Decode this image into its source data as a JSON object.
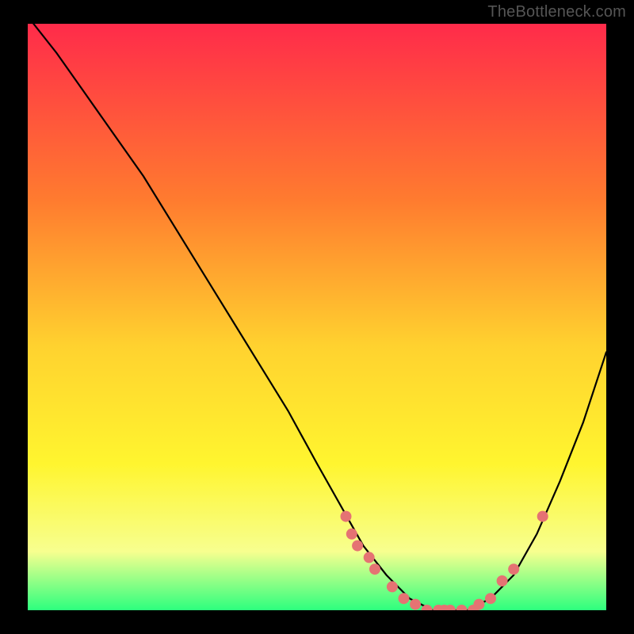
{
  "watermark": "TheBottleneck.com",
  "colors": {
    "background": "#000000",
    "gradient_top": "#ff2b4a",
    "gradient_mid1": "#ff7b2f",
    "gradient_mid2": "#ffd22f",
    "gradient_mid3": "#fff52f",
    "gradient_bottom_band": "#f7ff8f",
    "gradient_bottom": "#2dff7e",
    "curve": "#000000",
    "marker": "#e57373"
  },
  "chart_data": {
    "type": "line",
    "title": "",
    "xlabel": "",
    "ylabel": "",
    "xlim": [
      0,
      100
    ],
    "ylim": [
      0,
      100
    ],
    "grid": false,
    "legend": false,
    "series": [
      {
        "name": "curve",
        "x": [
          1,
          5,
          10,
          15,
          20,
          25,
          30,
          35,
          40,
          45,
          50,
          54,
          58,
          62,
          66,
          70,
          73,
          76,
          80,
          84,
          88,
          92,
          96,
          100
        ],
        "y": [
          100,
          95,
          88,
          81,
          74,
          66,
          58,
          50,
          42,
          34,
          25,
          18,
          11,
          6,
          2,
          0,
          0,
          0,
          2,
          6,
          13,
          22,
          32,
          44
        ]
      }
    ],
    "markers": [
      {
        "x": 55,
        "y": 16
      },
      {
        "x": 56,
        "y": 13
      },
      {
        "x": 57,
        "y": 11
      },
      {
        "x": 59,
        "y": 9
      },
      {
        "x": 60,
        "y": 7
      },
      {
        "x": 63,
        "y": 4
      },
      {
        "x": 65,
        "y": 2
      },
      {
        "x": 67,
        "y": 1
      },
      {
        "x": 69,
        "y": 0
      },
      {
        "x": 71,
        "y": 0
      },
      {
        "x": 72,
        "y": 0
      },
      {
        "x": 73,
        "y": 0
      },
      {
        "x": 75,
        "y": 0
      },
      {
        "x": 77,
        "y": 0
      },
      {
        "x": 78,
        "y": 1
      },
      {
        "x": 80,
        "y": 2
      },
      {
        "x": 82,
        "y": 5
      },
      {
        "x": 84,
        "y": 7
      },
      {
        "x": 89,
        "y": 16
      }
    ]
  }
}
